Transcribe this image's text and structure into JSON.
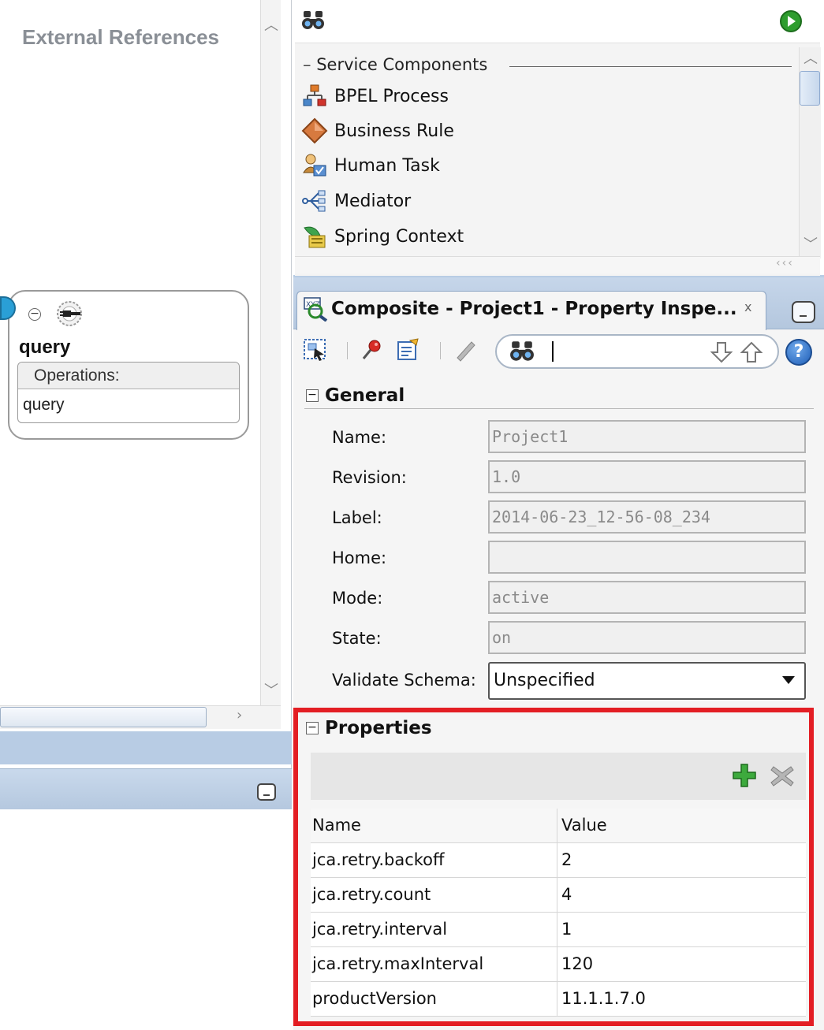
{
  "left": {
    "title": "External References",
    "reference": {
      "name": "query",
      "ops_header": "Operations:",
      "operation": "query"
    }
  },
  "palette": {
    "section": "Service Components",
    "items": [
      {
        "label": "BPEL Process",
        "icon": "bpel-process-icon"
      },
      {
        "label": "Business Rule",
        "icon": "business-rule-icon"
      },
      {
        "label": "Human Task",
        "icon": "human-task-icon"
      },
      {
        "label": "Mediator",
        "icon": "mediator-icon"
      },
      {
        "label": "Spring Context",
        "icon": "spring-context-icon"
      }
    ]
  },
  "inspector": {
    "tab_title": "Composite - Project1 - Property Inspe...",
    "close": "x",
    "help": "?",
    "general": {
      "title": "General",
      "fields": [
        {
          "label": "Name:",
          "value": "Project1"
        },
        {
          "label": "Revision:",
          "value": "1.0"
        },
        {
          "label": "Label:",
          "value": "2014-06-23_12-56-08_234"
        },
        {
          "label": "Home:",
          "value": ""
        },
        {
          "label": "Mode:",
          "value": "active"
        },
        {
          "label": "State:",
          "value": "on"
        }
      ],
      "validate_label": "Validate Schema:",
      "validate_value": "Unspecified"
    },
    "properties": {
      "title": "Properties",
      "columns": [
        "Name",
        "Value"
      ],
      "rows": [
        {
          "name": "jca.retry.backoff",
          "value": "2"
        },
        {
          "name": "jca.retry.count",
          "value": "4"
        },
        {
          "name": "jca.retry.interval",
          "value": "1"
        },
        {
          "name": "jca.retry.maxInterval",
          "value": "120"
        },
        {
          "name": "productVersion",
          "value": "11.1.1.7.0"
        }
      ]
    }
  },
  "colors": {
    "highlight": "#e31e24",
    "band": "#b8cce4"
  }
}
